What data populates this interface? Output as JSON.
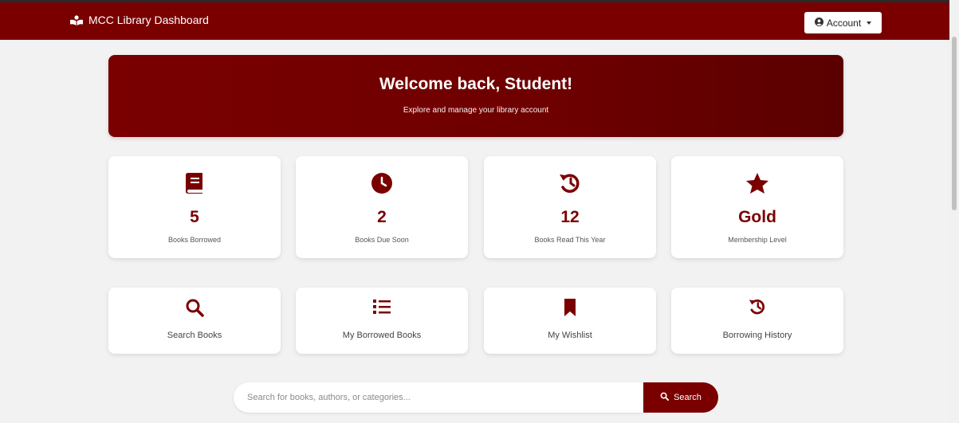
{
  "navbar": {
    "brand_icon": "book-reader-icon",
    "brand": "MCC Library Dashboard",
    "account_icon": "user-circle-icon",
    "account_label": "Account"
  },
  "hero": {
    "title": "Welcome back, Student!",
    "subtitle": "Explore and manage your library account"
  },
  "stats": [
    {
      "icon": "book-icon",
      "value": "5",
      "label": "Books Borrowed"
    },
    {
      "icon": "clock-icon",
      "value": "2",
      "label": "Books Due Soon"
    },
    {
      "icon": "history-icon",
      "value": "12",
      "label": "Books Read This Year"
    },
    {
      "icon": "star-icon",
      "value": "Gold",
      "label": "Membership Level"
    }
  ],
  "actions": [
    {
      "icon": "search-icon",
      "label": "Search Books"
    },
    {
      "icon": "list-icon",
      "label": "My Borrowed Books"
    },
    {
      "icon": "bookmark-icon",
      "label": "My Wishlist"
    },
    {
      "icon": "history-icon",
      "label": "Borrowing History"
    }
  ],
  "search": {
    "placeholder": "Search for books, authors, or categories...",
    "value": "",
    "button_icon": "search-icon",
    "button_label": "Search"
  },
  "colors": {
    "primary": "#7a0000",
    "background": "#f2f2f2",
    "card": "#ffffff"
  }
}
